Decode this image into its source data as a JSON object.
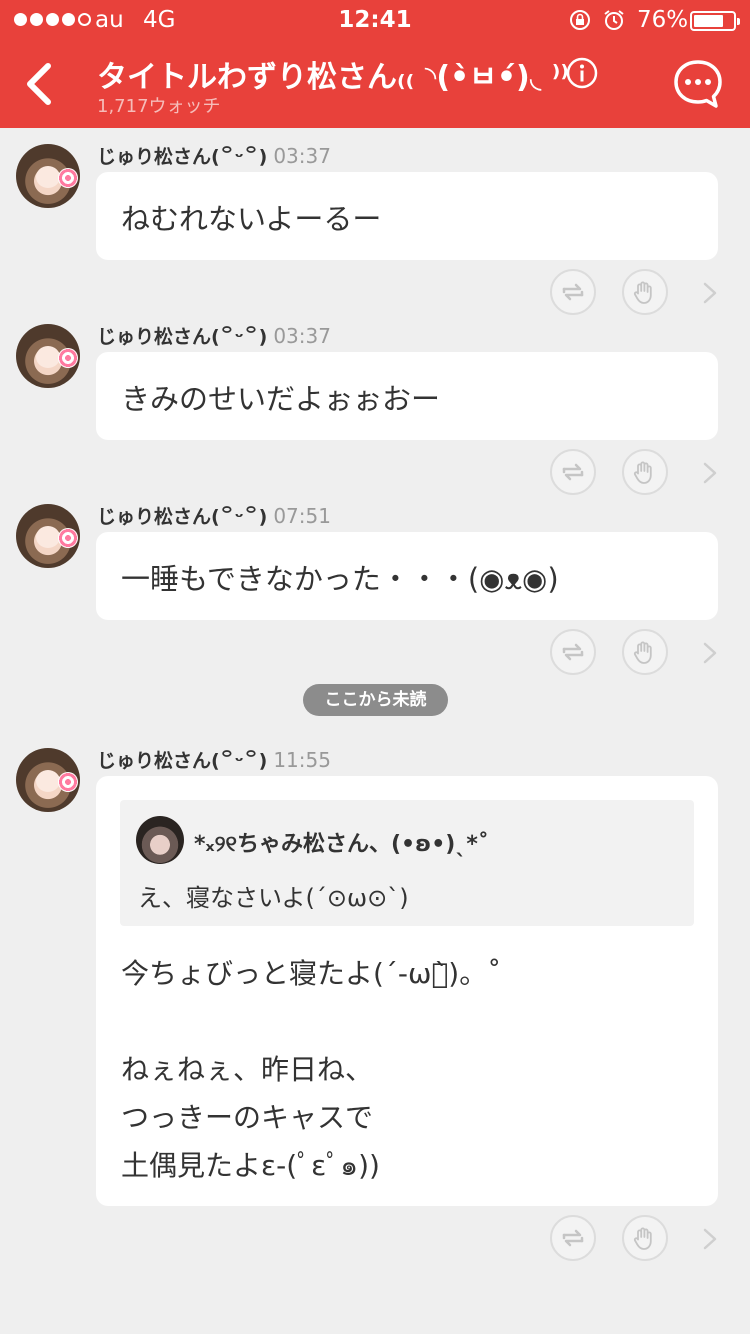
{
  "status_bar": {
    "carrier": "au",
    "network": "4G",
    "time": "12:41",
    "battery_percent": "76%",
    "battery_level": 0.76,
    "signal_bars_filled": 4,
    "signal_bars_total": 5
  },
  "header": {
    "title": "タイトルわずり松さん₍₍ ◝(•̀ㅂ•́)◟ ⁾⁾",
    "subtitle": "1,717ウォッチ",
    "accent_color": "#e8413b"
  },
  "posts": [
    {
      "author": "じゅり松さん(꒪ᵕ꒪)",
      "time": "03:37",
      "lines": [
        "ねむれないよーるー"
      ]
    },
    {
      "author": "じゅり松さん(꒪ᵕ꒪)",
      "time": "03:37",
      "lines": [
        "きみのせいだよぉぉおー"
      ]
    },
    {
      "author": "じゅり松さん(꒪ᵕ꒪)",
      "time": "07:51",
      "lines": [
        "一睡もできなかった・・・(◉ᴥ◉)"
      ]
    },
    {
      "author": "じゅり松さん(꒪ᵕ꒪)",
      "time": "11:55",
      "quote": {
        "author": "*ₓ୨୧ちゃみ松さん、(•ʚ•)ˎ*˚",
        "text": "え、寝なさいよ(´⊙ω⊙`)"
      },
      "lines": [
        "今ちょびっと寝たよ(´-ωก̀)。˚",
        "",
        "ねぇねぇ、昨日ね、",
        "つっきーのキャスで",
        "土偶見たよε-(ﾟεﾟ๑))"
      ]
    }
  ],
  "unread_divider": "ここから未読",
  "icons": {
    "back": "chevron-left-icon",
    "info": "info-icon",
    "chat": "chat-bubble-icon",
    "repost": "repost-icon",
    "clap": "clap-hand-icon",
    "more": "chevron-right-icon"
  }
}
